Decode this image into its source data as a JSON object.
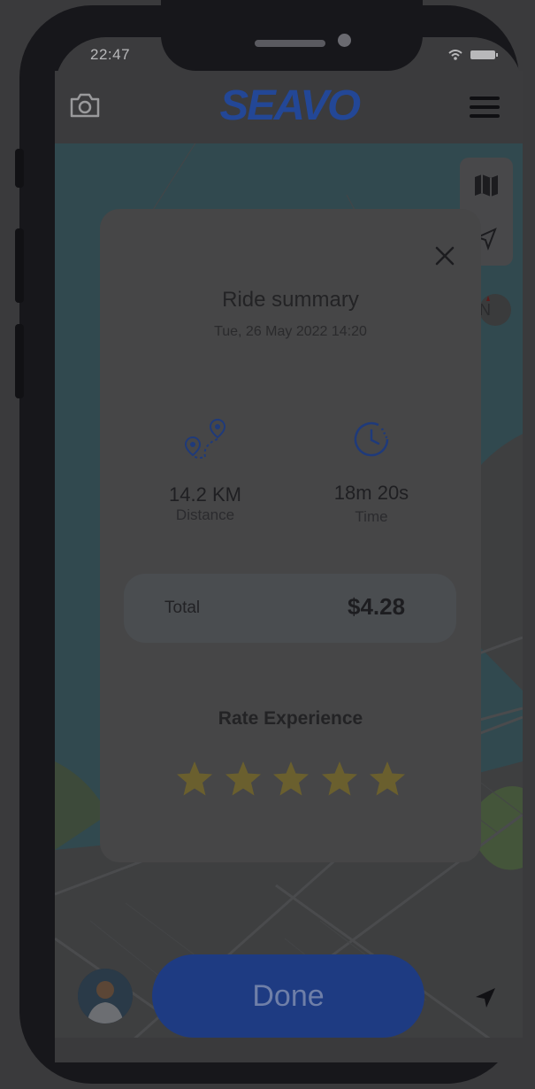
{
  "status_bar": {
    "time": "22:47"
  },
  "header": {
    "logo": "SEAVO",
    "camera_icon": "camera-icon",
    "menu_icon": "hamburger-menu-icon"
  },
  "map_controls": {
    "layers_icon": "map-icon",
    "recenter_icon": "send-arrow-icon",
    "compass_label": "N"
  },
  "modal": {
    "title": "Ride summary",
    "date": "Tue, 26 May 2022 14:20",
    "distance": {
      "value": "14.2 KM",
      "label": "Distance",
      "icon": "route-pins-icon"
    },
    "time": {
      "value": "18m 20s",
      "label": "Time",
      "icon": "clock-icon"
    },
    "total": {
      "label": "Total",
      "value": "$4.28"
    },
    "rate": {
      "title": "Rate Experience",
      "stars": 5,
      "max_stars": 5
    },
    "close_icon": "close-icon"
  },
  "footer": {
    "done_label": "Done",
    "avatar": "avatar",
    "location_icon": "location-arrow-icon"
  },
  "colors": {
    "brand": "#2a56c6",
    "star": "#e4c94a",
    "overlay": "rgba(0,0,0,0.72)"
  }
}
